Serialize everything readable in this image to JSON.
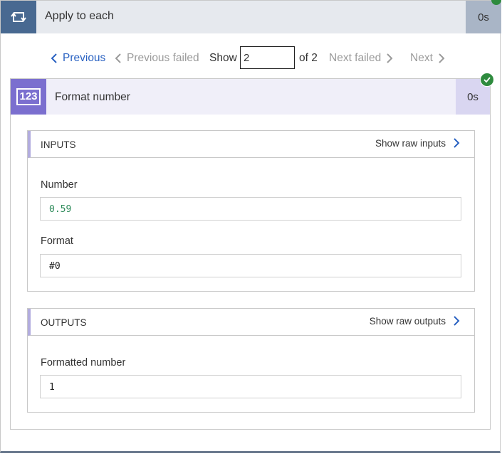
{
  "loop": {
    "title": "Apply to each",
    "duration": "0s",
    "icon": "loop-icon",
    "colors": {
      "icon_bg": "#486991",
      "header_bg": "#e6e9ee",
      "duration_bg": "#a9b5c6"
    }
  },
  "pager": {
    "previous": "Previous",
    "previous_failed": "Previous failed",
    "show_label": "Show",
    "current_value": "2",
    "of_total": "of 2",
    "next_failed": "Next failed",
    "next": "Next",
    "colors": {
      "link": "#2a62c2",
      "disabled": "#9b9b9b"
    }
  },
  "action": {
    "icon_text": "123",
    "title": "Format number",
    "duration": "0s",
    "status": "succeeded",
    "colors": {
      "icon_bg": "#7b6fcf",
      "header_bg": "#f0eff9",
      "duration_bg": "#d9d6f1",
      "success": "#2e8b3e"
    },
    "inputs": {
      "title": "INPUTS",
      "raw_link": "Show raw inputs",
      "fields": [
        {
          "label": "Number",
          "value": "0.59"
        },
        {
          "label": "Format",
          "value": "#0"
        }
      ]
    },
    "outputs": {
      "title": "OUTPUTS",
      "raw_link": "Show raw outputs",
      "fields": [
        {
          "label": "Formatted number",
          "value": "1"
        }
      ]
    }
  }
}
